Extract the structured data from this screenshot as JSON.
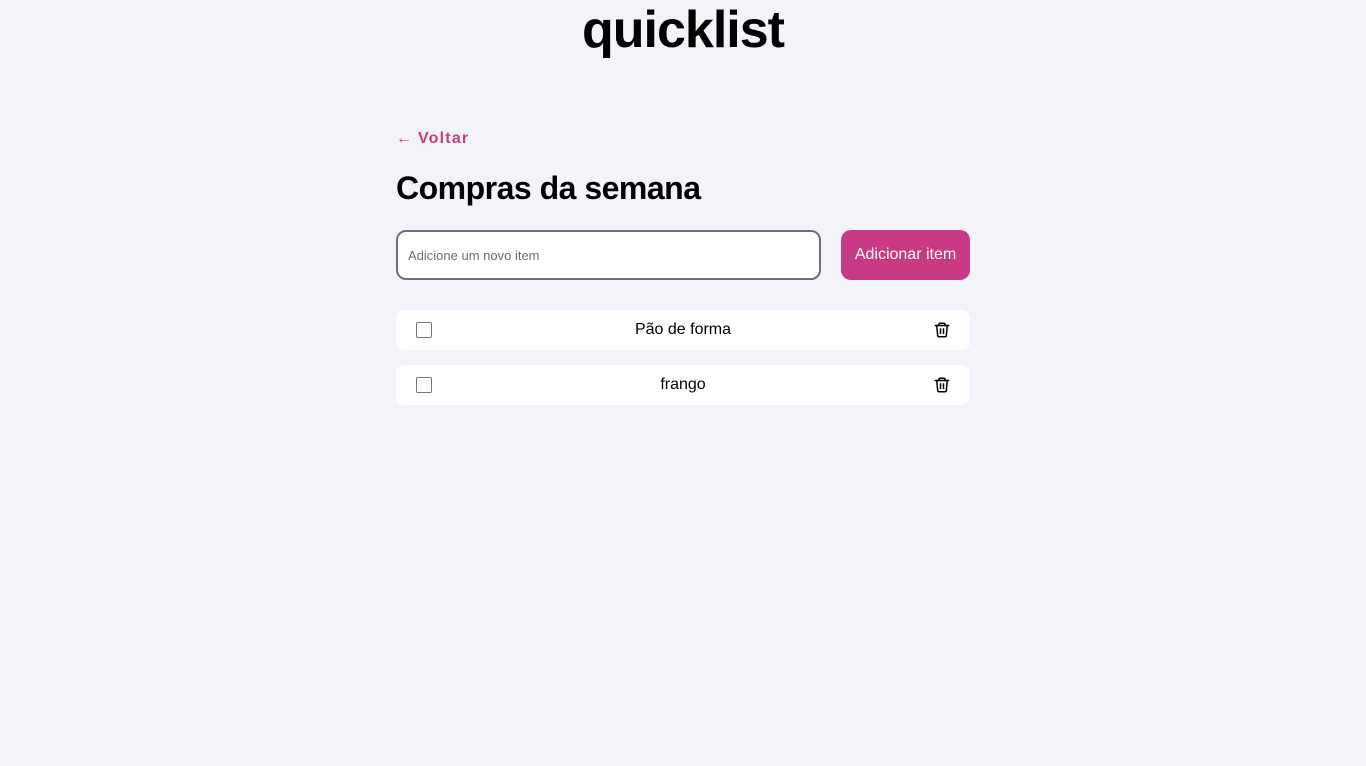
{
  "app": {
    "title": "quicklist"
  },
  "nav": {
    "back_arrow": "←",
    "back_label": "Voltar"
  },
  "page": {
    "title": "Compras da semana"
  },
  "add_form": {
    "input_value": "",
    "input_placeholder": "Adicione um novo item",
    "button_label": "Adicionar item"
  },
  "items": [
    {
      "label": "Pão de forma",
      "checked": false,
      "delete_icon": "trash-icon"
    },
    {
      "label": "frango",
      "checked": false,
      "delete_icon": "trash-icon"
    }
  ],
  "colors": {
    "accent": "#c93a85",
    "background": "#f3f4f9",
    "card": "#ffffff",
    "input_border": "#6f6f74"
  }
}
